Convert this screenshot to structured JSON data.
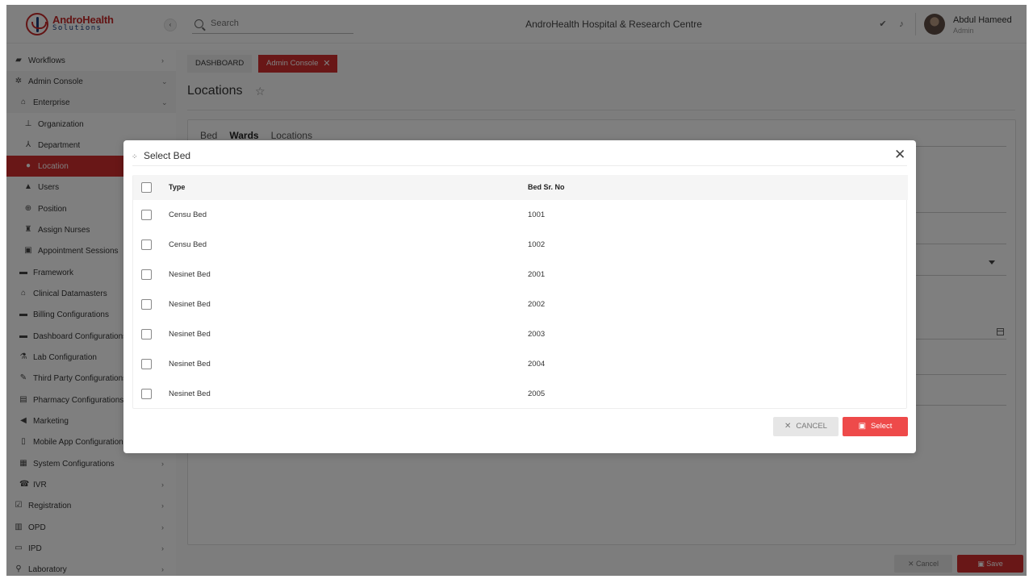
{
  "app": {
    "logo_name": "AndroHealth",
    "logo_sub": "Solutions",
    "collapse_icon": "‹"
  },
  "header": {
    "search_placeholder": "Search",
    "hospital_title": "AndroHealth Hospital & Research Centre",
    "user_name": "Abdul Hameed",
    "user_role": "Admin"
  },
  "sidebar": {
    "items": [
      {
        "label": "Workflows",
        "icon": "monitor-icon",
        "glyph": "▰",
        "chev": "›"
      },
      {
        "label": "Admin Console",
        "icon": "gear-icon",
        "glyph": "✲",
        "chev": "⌄"
      },
      {
        "label": "Enterprise",
        "icon": "bank-icon",
        "glyph": "⌂",
        "chev": "⌄"
      },
      {
        "label": "Organization",
        "icon": "sitemap-icon",
        "glyph": "⊥"
      },
      {
        "label": "Department",
        "icon": "hierarchy-icon",
        "glyph": "⅄"
      },
      {
        "label": "Location",
        "icon": "pin-icon",
        "glyph": "●"
      },
      {
        "label": "Users",
        "icon": "user-icon",
        "glyph": "▲"
      },
      {
        "label": "Position",
        "icon": "position-icon",
        "glyph": "⊕"
      },
      {
        "label": "Assign Nurses",
        "icon": "nurse-icon",
        "glyph": "♜"
      },
      {
        "label": "Appointment Sessions",
        "icon": "calendar-icon",
        "glyph": "▣"
      },
      {
        "label": "Framework",
        "icon": "framework-icon",
        "glyph": "▬"
      },
      {
        "label": "Clinical Datamasters",
        "icon": "home-icon",
        "glyph": "⌂"
      },
      {
        "label": "Billing Configurations",
        "icon": "billing-icon",
        "glyph": "▬"
      },
      {
        "label": "Dashboard Configurations",
        "icon": "dashboard-icon",
        "glyph": "▬"
      },
      {
        "label": "Lab Configuration",
        "icon": "flask-icon",
        "glyph": "⚗"
      },
      {
        "label": "Third Party Configurations",
        "icon": "plug-icon",
        "glyph": "✎"
      },
      {
        "label": "Pharmacy Configurations",
        "icon": "pharmacy-icon",
        "glyph": "▤"
      },
      {
        "label": "Marketing",
        "icon": "megaphone-icon",
        "glyph": "◀"
      },
      {
        "label": "Mobile App Configurations",
        "icon": "mobile-icon",
        "glyph": "▯"
      },
      {
        "label": "System Configurations",
        "icon": "system-icon",
        "glyph": "▦",
        "chev": "›"
      },
      {
        "label": "IVR",
        "icon": "ivr-icon",
        "glyph": "☎",
        "chev": "›"
      },
      {
        "label": "Registration",
        "icon": "registration-icon",
        "glyph": "☑",
        "chev": "›"
      },
      {
        "label": "OPD",
        "icon": "opd-icon",
        "glyph": "▥",
        "chev": "›"
      },
      {
        "label": "IPD",
        "icon": "bed-icon",
        "glyph": "▭",
        "chev": "›"
      },
      {
        "label": "Laboratory",
        "icon": "laboratory-icon",
        "glyph": "⚲",
        "chev": "›"
      }
    ]
  },
  "main": {
    "breadcrumb_dashboard": "DASHBOARD",
    "breadcrumb_admin": "Admin Console",
    "page_title": "Locations",
    "tabs": [
      "Bed",
      "Wards",
      "Locations"
    ],
    "cancel_label": "Cancel",
    "save_label": "Save"
  },
  "modal": {
    "title": "Select Bed",
    "columns": [
      "Type",
      "Bed Sr. No"
    ],
    "rows": [
      {
        "type": "Censu Bed",
        "sr": "1001"
      },
      {
        "type": "Censu Bed",
        "sr": "1002"
      },
      {
        "type": "Nesinet Bed",
        "sr": "2001"
      },
      {
        "type": "Nesinet Bed",
        "sr": "2002"
      },
      {
        "type": "Nesinet Bed",
        "sr": "2003"
      },
      {
        "type": "Nesinet Bed",
        "sr": "2004"
      },
      {
        "type": "Nesinet Bed",
        "sr": "2005"
      }
    ],
    "cancel_label": "CANCEL",
    "select_label": "Select"
  },
  "colors": {
    "accent": "#d32f2f",
    "select_button": "#ee4a4a"
  }
}
